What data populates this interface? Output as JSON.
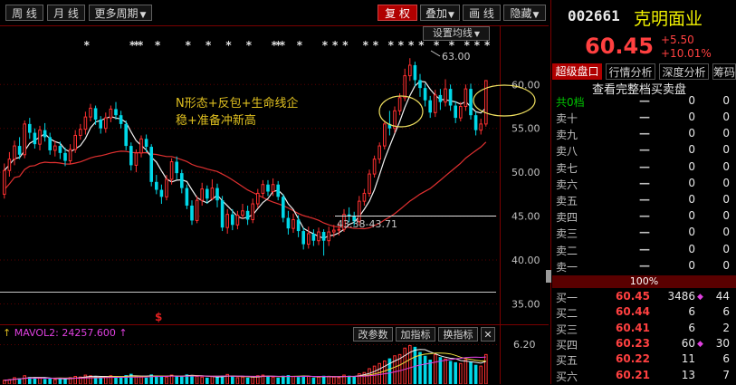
{
  "toolbar": {
    "btn_week": "周 线",
    "btn_month": "月 线",
    "btn_more_period": "更多周期",
    "btn_fuquan": "复 权",
    "btn_overlay": "叠加",
    "btn_draw": "画 线",
    "btn_hide": "隐藏",
    "dropdown_glyph": "▼"
  },
  "chart": {
    "ma_setting_label": "设置均线",
    "annotation_line1": "N形态+反包+生命线企",
    "annotation_line2": "稳+准备冲新高",
    "high_label": "63.00",
    "range_label": "43.38-43.71",
    "s_marker": "$",
    "y_ticks": [
      "60.00",
      "55.00",
      "50.00",
      "45.00",
      "40.00",
      "35.00"
    ],
    "vol_tick": "6.20",
    "star_glyph": "*"
  },
  "volume_panel": {
    "indicator": "MAVOL2: 24257.600",
    "btn_change_params": "改参数",
    "btn_add_indicator": "加指标",
    "btn_switch_indicator": "换指标",
    "btn_close": "✕"
  },
  "quote": {
    "code": "002661",
    "name": "克明面业",
    "price": "60.45",
    "change": "+5.50",
    "change_pct": "+10.01%",
    "tabs": [
      "超级盘口",
      "行情分析",
      "深度分析",
      "筹码"
    ],
    "view_full": "查看完整档买卖盘",
    "total_level": "共0档",
    "pct_bar": "100%"
  },
  "order_book": {
    "asks": [
      {
        "label": "卖十",
        "price": "—",
        "vol": "0",
        "n": "0"
      },
      {
        "label": "卖九",
        "price": "—",
        "vol": "0",
        "n": "0"
      },
      {
        "label": "卖八",
        "price": "—",
        "vol": "0",
        "n": "0"
      },
      {
        "label": "卖七",
        "price": "—",
        "vol": "0",
        "n": "0"
      },
      {
        "label": "卖六",
        "price": "—",
        "vol": "0",
        "n": "0"
      },
      {
        "label": "卖五",
        "price": "—",
        "vol": "0",
        "n": "0"
      },
      {
        "label": "卖四",
        "price": "—",
        "vol": "0",
        "n": "0"
      },
      {
        "label": "卖三",
        "price": "—",
        "vol": "0",
        "n": "0"
      },
      {
        "label": "卖二",
        "price": "—",
        "vol": "0",
        "n": "0"
      },
      {
        "label": "卖一",
        "price": "—",
        "vol": "0",
        "n": "0"
      }
    ],
    "first_row": {
      "price": "—",
      "vol": "0",
      "n": "0"
    },
    "bids": [
      {
        "label": "买一",
        "price": "60.45",
        "vol": "3486",
        "n": "44"
      },
      {
        "label": "买二",
        "price": "60.44",
        "vol": "6",
        "n": "6"
      },
      {
        "label": "买三",
        "price": "60.41",
        "vol": "6",
        "n": "2"
      },
      {
        "label": "买四",
        "price": "60.23",
        "vol": "60",
        "n": "30"
      },
      {
        "label": "买五",
        "price": "60.22",
        "vol": "11",
        "n": "6"
      },
      {
        "label": "买六",
        "price": "60.21",
        "vol": "13",
        "n": "7"
      }
    ],
    "diamond_glyph": "◆"
  },
  "chart_data": {
    "type": "candlestick",
    "ylim": [
      33.5,
      65.5
    ],
    "candles": [
      [
        47.5,
        50.2,
        51.0,
        47.0
      ],
      [
        50.2,
        51.5,
        52.3,
        49.5
      ],
      [
        51.5,
        53.0,
        53.6,
        50.8
      ],
      [
        53.0,
        52.0,
        54.0,
        51.5
      ],
      [
        52.0,
        55.5,
        55.9,
        51.6
      ],
      [
        55.5,
        54.5,
        56.2,
        53.8
      ],
      [
        54.5,
        53.2,
        55.0,
        52.7
      ],
      [
        53.2,
        54.8,
        55.3,
        52.5
      ],
      [
        54.8,
        54.0,
        55.6,
        53.5
      ],
      [
        54.0,
        52.5,
        54.5,
        52.0
      ],
      [
        52.5,
        53.0,
        53.6,
        51.8
      ],
      [
        53.0,
        52.2,
        53.5,
        51.5
      ],
      [
        52.2,
        51.3,
        52.8,
        50.7
      ],
      [
        51.3,
        52.6,
        53.2,
        51.0
      ],
      [
        52.6,
        54.2,
        54.8,
        52.2
      ],
      [
        54.2,
        54.9,
        55.5,
        53.7
      ],
      [
        54.9,
        56.3,
        56.9,
        54.3
      ],
      [
        56.3,
        57.3,
        57.8,
        55.8
      ],
      [
        57.3,
        56.0,
        57.6,
        55.4
      ],
      [
        56.0,
        55.0,
        56.4,
        54.4
      ],
      [
        55.0,
        56.2,
        56.8,
        54.5
      ],
      [
        56.2,
        57.2,
        57.6,
        55.7
      ],
      [
        57.2,
        56.5,
        58.0,
        56.0
      ],
      [
        56.5,
        55.5,
        57.0,
        55.0
      ],
      [
        55.5,
        53.0,
        55.9,
        52.5
      ],
      [
        53.0,
        50.8,
        53.4,
        50.2
      ],
      [
        50.8,
        52.2,
        52.6,
        50.0
      ],
      [
        52.2,
        53.8,
        54.2,
        51.7
      ],
      [
        53.8,
        52.9,
        54.3,
        52.3
      ],
      [
        52.9,
        48.9,
        53.2,
        48.4
      ],
      [
        48.9,
        48.0,
        49.7,
        47.5
      ],
      [
        48.0,
        47.2,
        48.6,
        46.4
      ],
      [
        47.2,
        49.2,
        49.7,
        46.8
      ],
      [
        49.2,
        51.2,
        51.6,
        48.6
      ],
      [
        51.2,
        49.9,
        51.8,
        49.2
      ],
      [
        49.9,
        48.2,
        50.3,
        47.6
      ],
      [
        48.2,
        46.2,
        48.6,
        45.8
      ],
      [
        46.2,
        44.5,
        46.8,
        44.0
      ],
      [
        44.5,
        46.8,
        47.3,
        44.2
      ],
      [
        46.8,
        48.1,
        48.8,
        46.2
      ],
      [
        48.1,
        47.0,
        48.5,
        46.4
      ],
      [
        47.0,
        48.2,
        49.2,
        46.8
      ],
      [
        48.2,
        46.8,
        48.7,
        46.0
      ],
      [
        46.8,
        43.7,
        47.3,
        43.3
      ],
      [
        43.7,
        45.2,
        45.8,
        43.0
      ],
      [
        45.2,
        44.0,
        45.8,
        43.4
      ],
      [
        44.0,
        45.1,
        45.6,
        43.5
      ],
      [
        45.1,
        45.6,
        46.4,
        44.7
      ],
      [
        45.6,
        44.6,
        46.2,
        44.0
      ],
      [
        44.6,
        46.4,
        47.0,
        44.2
      ],
      [
        46.4,
        47.6,
        48.1,
        45.9
      ],
      [
        47.6,
        48.6,
        49.1,
        47.1
      ],
      [
        48.6,
        47.8,
        49.1,
        47.3
      ],
      [
        47.8,
        48.6,
        49.3,
        47.3
      ],
      [
        48.6,
        47.2,
        49.0,
        46.8
      ],
      [
        47.2,
        44.8,
        47.5,
        44.3
      ],
      [
        44.8,
        43.6,
        45.6,
        42.9
      ],
      [
        43.6,
        44.6,
        45.3,
        43.1
      ],
      [
        44.6,
        43.3,
        45.1,
        42.6
      ],
      [
        43.3,
        41.8,
        43.7,
        41.2
      ],
      [
        41.8,
        43.0,
        43.8,
        41.3
      ],
      [
        43.0,
        42.2,
        43.5,
        41.6
      ],
      [
        42.2,
        43.2,
        43.7,
        41.7
      ],
      [
        43.2,
        42.2,
        43.5,
        40.5
      ],
      [
        42.2,
        43.2,
        43.8,
        41.6
      ],
      [
        43.2,
        43.4,
        44.0,
        42.6
      ],
      [
        43.4,
        43.5,
        44.3,
        42.8
      ],
      [
        43.5,
        45.2,
        45.8,
        43.2
      ],
      [
        45.2,
        45.0,
        46.0,
        44.3
      ],
      [
        45.0,
        44.4,
        45.5,
        43.9
      ],
      [
        44.4,
        46.7,
        47.3,
        44.0
      ],
      [
        46.7,
        47.6,
        48.1,
        46.2
      ],
      [
        47.6,
        49.8,
        50.3,
        47.2
      ],
      [
        49.8,
        51.5,
        51.9,
        49.4
      ],
      [
        51.5,
        53.0,
        53.4,
        51.0
      ],
      [
        53.0,
        55.5,
        55.9,
        52.6
      ],
      [
        55.5,
        55.0,
        57.0,
        54.2
      ],
      [
        55.0,
        57.0,
        57.5,
        54.5
      ],
      [
        57.0,
        58.5,
        59.0,
        56.5
      ],
      [
        58.5,
        61.0,
        61.8,
        58.1
      ],
      [
        61.0,
        62.2,
        63.0,
        60.4
      ],
      [
        62.2,
        60.5,
        62.6,
        59.8
      ],
      [
        60.5,
        59.6,
        61.2,
        58.6
      ],
      [
        59.6,
        58.2,
        60.1,
        57.5
      ],
      [
        58.2,
        56.8,
        58.7,
        56.2
      ],
      [
        56.8,
        58.8,
        59.4,
        56.3
      ],
      [
        58.8,
        58.0,
        59.5,
        57.1
      ],
      [
        58.0,
        59.5,
        60.6,
        57.5
      ],
      [
        59.5,
        57.6,
        60.0,
        57.0
      ],
      [
        57.6,
        56.2,
        58.1,
        55.6
      ],
      [
        56.2,
        57.5,
        58.0,
        55.8
      ],
      [
        57.5,
        59.5,
        60.0,
        57.0
      ],
      [
        59.5,
        56.5,
        60.1,
        56.0
      ],
      [
        56.5,
        54.8,
        56.9,
        54.2
      ],
      [
        54.8,
        55.5,
        56.1,
        54.3
      ],
      [
        55.5,
        60.45,
        60.45,
        55.2
      ]
    ],
    "volumes": [
      0.6,
      0.7,
      1.0,
      0.9,
      1.3,
      1.1,
      0.9,
      1.0,
      0.8,
      0.9,
      0.7,
      0.8,
      0.9,
      1.0,
      1.2,
      1.1,
      1.4,
      1.3,
      1.2,
      1.0,
      1.1,
      1.3,
      1.2,
      1.0,
      1.4,
      1.6,
      1.2,
      1.1,
      1.0,
      1.5,
      1.3,
      1.2,
      1.1,
      1.4,
      1.2,
      1.3,
      1.5,
      1.4,
      1.2,
      1.1,
      1.0,
      1.2,
      1.1,
      1.3,
      1.5,
      1.2,
      1.0,
      1.1,
      1.0,
      1.2,
      1.3,
      1.4,
      1.2,
      1.1,
      1.0,
      1.3,
      1.4,
      1.2,
      1.1,
      1.3,
      1.2,
      1.0,
      1.1,
      1.3,
      1.2,
      1.1,
      1.0,
      1.4,
      1.3,
      1.2,
      1.6,
      1.8,
      2.4,
      2.8,
      3.2,
      3.6,
      4.0,
      4.4,
      4.6,
      5.6,
      6.0,
      5.8,
      5.0,
      4.4,
      3.8,
      4.6,
      4.2,
      3.9,
      3.6,
      3.4,
      3.2,
      3.8,
      3.5,
      3.0,
      2.8,
      4.6
    ],
    "vol_max": 6.2,
    "star_groups": [
      [
        16,
        1
      ],
      [
        25,
        3
      ],
      [
        30,
        1
      ],
      [
        36,
        1
      ],
      [
        40,
        1
      ],
      [
        44,
        1
      ],
      [
        48,
        1
      ],
      [
        53,
        3
      ],
      [
        58,
        1
      ],
      [
        63,
        1
      ],
      [
        65,
        1
      ],
      [
        67,
        1
      ],
      [
        71,
        1
      ],
      [
        73,
        1
      ],
      [
        76,
        1
      ],
      [
        78,
        1
      ],
      [
        80,
        1
      ],
      [
        82,
        1
      ],
      [
        85,
        1
      ],
      [
        88,
        1
      ],
      [
        91,
        1
      ],
      [
        93,
        1
      ],
      [
        95,
        1
      ]
    ]
  }
}
